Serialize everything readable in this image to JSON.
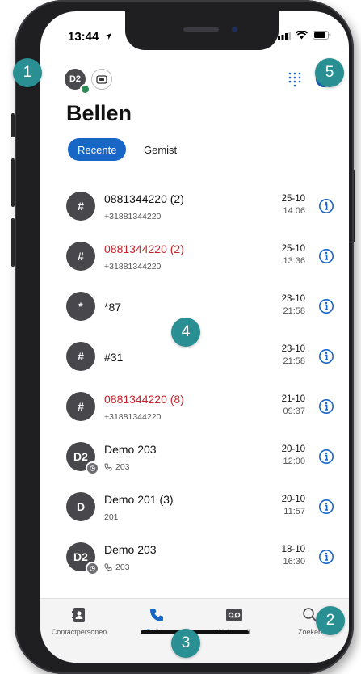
{
  "status": {
    "time": "13:44"
  },
  "header": {
    "avatar_initials": "D2",
    "title": "Bellen"
  },
  "filters": {
    "active": "Recente",
    "other": "Gemist"
  },
  "calls": [
    {
      "initial": "#",
      "name": "0881344220 (2)",
      "missed": false,
      "sub": "+31881344220",
      "sub_icon": false,
      "date": "25-10",
      "time": "14:06",
      "badge": false
    },
    {
      "initial": "#",
      "name": "0881344220 (2)",
      "missed": true,
      "sub": "+31881344220",
      "sub_icon": false,
      "date": "25-10",
      "time": "13:36",
      "badge": false
    },
    {
      "initial": "*",
      "name": "*87",
      "missed": false,
      "sub": "",
      "sub_icon": false,
      "date": "23-10",
      "time": "21:58",
      "badge": false
    },
    {
      "initial": "#",
      "name": "#31",
      "missed": false,
      "sub": "",
      "sub_icon": false,
      "date": "23-10",
      "time": "21:58",
      "badge": false
    },
    {
      "initial": "#",
      "name": "0881344220 (8)",
      "missed": true,
      "sub": "+31881344220",
      "sub_icon": false,
      "date": "21-10",
      "time": "09:37",
      "badge": false
    },
    {
      "initial": "D2",
      "name": "Demo 203",
      "missed": false,
      "sub": "203",
      "sub_icon": true,
      "date": "20-10",
      "time": "12:00",
      "badge": true
    },
    {
      "initial": "D",
      "name": "Demo 201 (3)",
      "missed": false,
      "sub": "201",
      "sub_icon": false,
      "date": "20-10",
      "time": "11:57",
      "badge": false
    },
    {
      "initial": "D2",
      "name": "Demo 203",
      "missed": false,
      "sub": "203",
      "sub_icon": true,
      "date": "18-10",
      "time": "16:30",
      "badge": true
    }
  ],
  "tabs": [
    {
      "label": "Contactpersonen",
      "icon": "contacts-icon"
    },
    {
      "label": "Bellen",
      "icon": "phone-icon"
    },
    {
      "label": "Voicemail",
      "icon": "voicemail-icon"
    },
    {
      "label": "Zoeken",
      "icon": "search-icon"
    }
  ],
  "callouts": [
    "1",
    "2",
    "3",
    "4",
    "5"
  ],
  "colors": {
    "accent": "#1866c6",
    "missed": "#c4232b",
    "callout": "#2a8f92"
  }
}
